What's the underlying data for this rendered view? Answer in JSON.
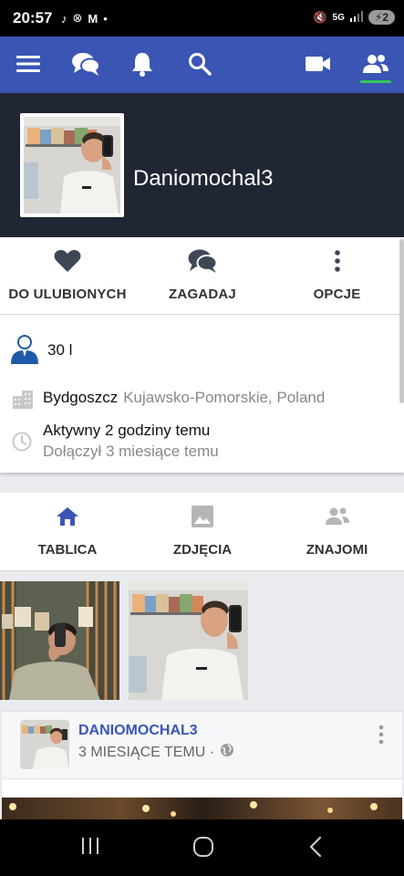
{
  "status": {
    "time": "20:57",
    "left_icons": [
      "tiktok-icon",
      "app-icon",
      "gmail-icon",
      "dot"
    ],
    "right_icons": [
      "mute-icon",
      "5g-icon",
      "signal-icon"
    ],
    "battery": "2"
  },
  "nav": {
    "items": [
      "menu-icon",
      "chat-icon",
      "bell-icon",
      "search-icon",
      "video-icon",
      "friends-icon"
    ],
    "active": "friends-icon",
    "accent": "#3b55b4"
  },
  "profile": {
    "username": "Daniomochal3"
  },
  "actions": [
    {
      "label": "DO ULUBIONYCH",
      "icon": "heart-icon"
    },
    {
      "label": "ZAGADAJ",
      "icon": "chat-icon"
    },
    {
      "label": "OPCJE",
      "icon": "more-vert-icon"
    }
  ],
  "info": {
    "age": "30 l",
    "city": "Bydgoszcz",
    "region": "Kujawsko-Pomorskie, Poland",
    "active": "Aktywny 2 godziny temu",
    "joined": "Dołączył 3 miesiące temu"
  },
  "tabs": [
    {
      "label": "TABLICA",
      "icon": "home-icon"
    },
    {
      "label": "ZDJĘCIA",
      "icon": "image-icon"
    },
    {
      "label": "ZNAJOMI",
      "icon": "people-icon"
    }
  ],
  "post": {
    "author": "DANIOMOCHAL3",
    "time": "3 MIESIĄCE TEMU ·"
  }
}
